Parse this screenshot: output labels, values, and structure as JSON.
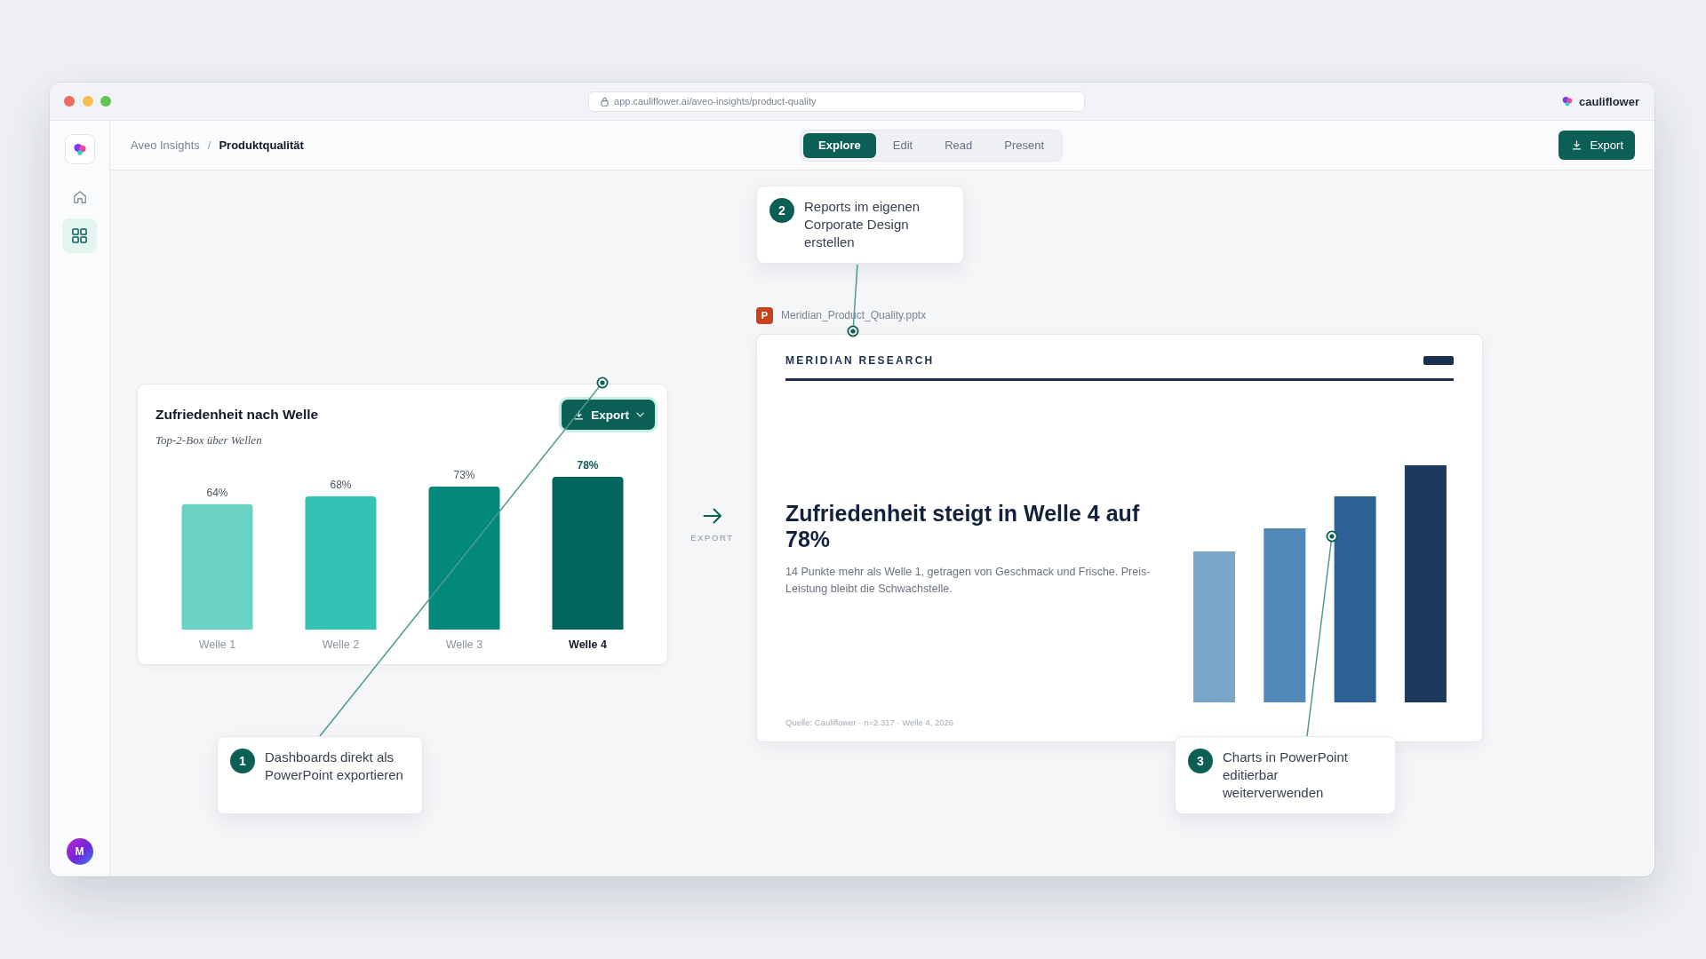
{
  "window": {
    "address_bar": {
      "value": "app.cauliflower.ai/aveo-insights/product-quality"
    },
    "brand": {
      "name": "cauliflower"
    }
  },
  "sidebar": {
    "items": [
      {
        "kind": "home",
        "selected": false
      },
      {
        "kind": "grid",
        "selected": true
      }
    ],
    "avatar": {
      "initial": "M"
    }
  },
  "toolbar": {
    "breadcrumb": [
      {
        "label": "Aveo Insights",
        "current": false
      },
      {
        "label": "Produktqualität",
        "current": true
      }
    ],
    "breadcrumb_separator": "/",
    "mode_tabs": [
      {
        "label": "Explore",
        "selected": true
      },
      {
        "label": "Edit",
        "selected": false
      },
      {
        "label": "Read",
        "selected": false
      },
      {
        "label": "Present",
        "selected": false
      }
    ],
    "export_button": {
      "label": "Export"
    }
  },
  "dashboard_card": {
    "title": "Zufriedenheit nach Welle",
    "subtitle": "Top-2-Box über Wellen",
    "export_button": {
      "label": "Export",
      "focused": true
    },
    "chart_data": {
      "type": "bar",
      "categories": [
        "Welle 1",
        "Welle 2",
        "Welle 3",
        "Welle 4"
      ],
      "values": [
        64,
        68,
        73,
        78
      ],
      "value_labels": [
        "64%",
        "68%",
        "73%",
        "78%"
      ]
    }
  },
  "export_arrow": {
    "label": "EXPORT"
  },
  "slide": {
    "file": {
      "badge": "P",
      "name": "Meridian_Product_Quality.pptx"
    },
    "brand": "MERIDIAN RESEARCH",
    "headline": "Zufriedenheit steigt in Welle 4 auf 78%",
    "body": "14 Punkte mehr als Welle 1, getragen von Geschmack und Frische. Preis-Leistung bleibt die Schwachstelle.",
    "source": "Quelle: Cauliflower · n=2.317 · Welle 4, 2026"
  },
  "callouts": [
    {
      "number": "1",
      "text": "Dashboards direkt als PowerPoint exportieren"
    },
    {
      "number": "2",
      "text": "Reports im eigenen Corporate Design erstellen"
    },
    {
      "number": "3",
      "text": "Charts in PowerPoint editierbar weiterverwenden"
    }
  ]
}
